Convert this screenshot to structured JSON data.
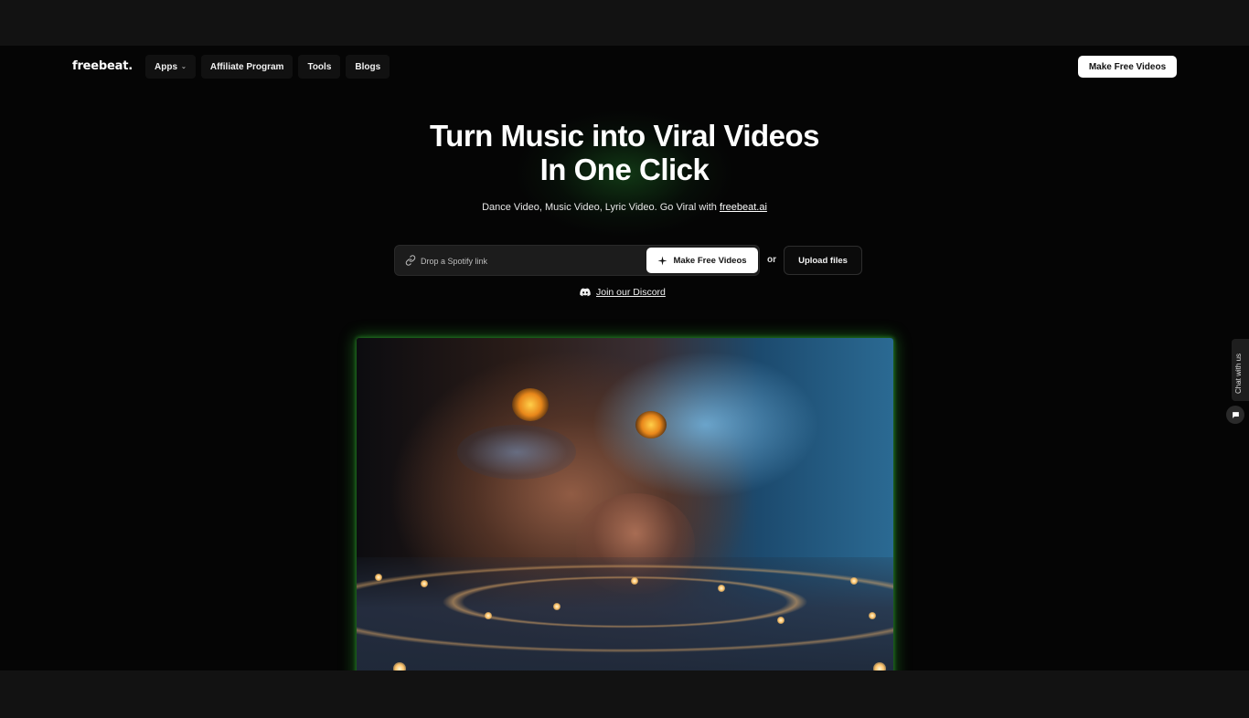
{
  "nav": {
    "logo": "freebeat.",
    "items": [
      {
        "label": "Apps",
        "dropdown": true
      },
      {
        "label": "Affiliate Program"
      },
      {
        "label": "Tools"
      },
      {
        "label": "Blogs"
      }
    ],
    "cta": "Make Free Videos"
  },
  "hero": {
    "headline_line1": "Turn Music into Viral Videos",
    "headline_line2": "In One Click",
    "subline_prefix": "Dance Video, Music Video, Lyric Video. Go Viral with ",
    "subline_link": "freebeat.ai"
  },
  "form": {
    "placeholder": "Drop a Spotify link",
    "make_button": "Make Free Videos",
    "or": "or",
    "upload_button": "Upload files"
  },
  "discord": {
    "label": "Join our Discord"
  },
  "chat": {
    "label": "Chat with us"
  },
  "colors": {
    "background": "#050505",
    "accent_glow": "#2fa83a",
    "button_bg": "#ffffff"
  },
  "icons": [
    "link-icon",
    "sparkle-icon",
    "discord-icon",
    "chat-icon",
    "chevron-down-icon"
  ]
}
